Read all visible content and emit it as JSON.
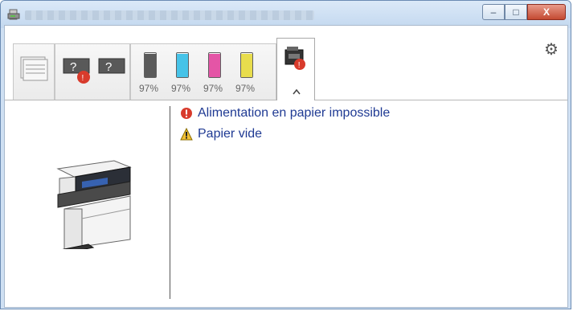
{
  "window": {
    "title": "",
    "controls": {
      "minimize": "–",
      "maximize": "□",
      "close": "X"
    }
  },
  "toolbar": {
    "tabs": [
      {
        "name": "pages",
        "icon": "pages-icon"
      },
      {
        "name": "printer-status",
        "icon": "question-icons"
      },
      {
        "name": "toner",
        "icon": "toner-icon"
      },
      {
        "name": "device-status",
        "icon": "device-error-icon"
      }
    ],
    "toners": [
      {
        "color": "#5a5a5a",
        "level_percent": 97,
        "label": "97%"
      },
      {
        "color": "#46c3e8",
        "level_percent": 97,
        "label": "97%"
      },
      {
        "color": "#e455a6",
        "level_percent": 97,
        "label": "97%"
      },
      {
        "color": "#e8dd4d",
        "level_percent": 97,
        "label": "97%"
      }
    ],
    "settings_icon": "gear-icon"
  },
  "messages": [
    {
      "severity": "error",
      "icon": "error-icon",
      "text": "Alimentation en papier impossible"
    },
    {
      "severity": "warning",
      "icon": "warning-icon",
      "text": "Papier vide"
    }
  ]
}
